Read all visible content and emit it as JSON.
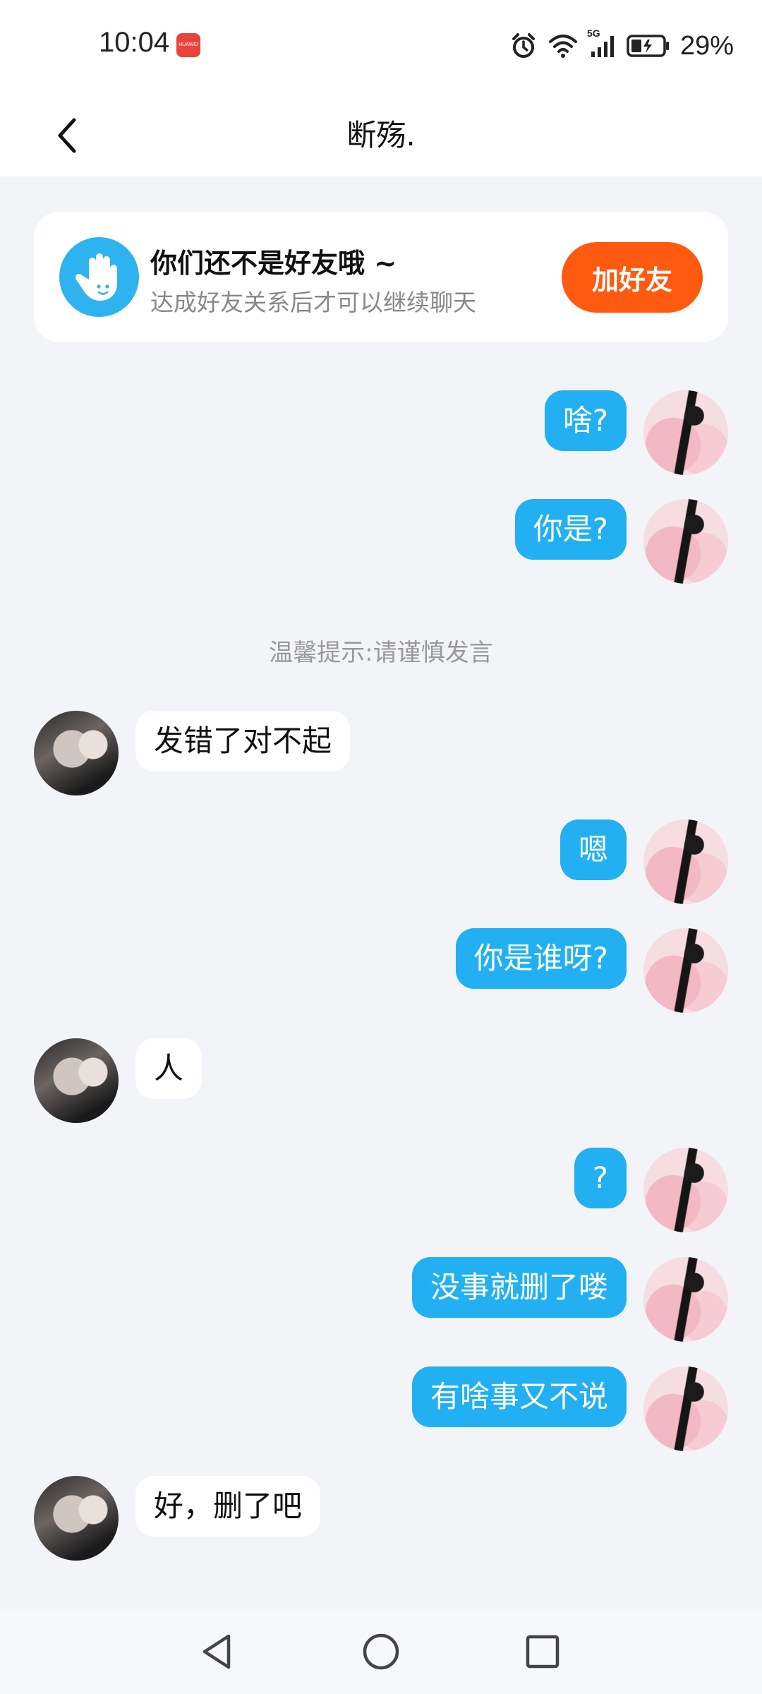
{
  "status_bar": {
    "time": "10:04",
    "app_badge": "HUAWEI",
    "network": "5G",
    "battery": "29%",
    "icons": [
      "alarm-icon",
      "wifi-icon",
      "signal-icon",
      "battery-icon"
    ]
  },
  "header": {
    "title": "断殇."
  },
  "friend_notice": {
    "title": "你们还不是好友哦 ~",
    "subtitle": "达成好友关系后才可以继续聊天",
    "button_label": "加好友"
  },
  "tip": "温馨提示:请谨慎发言",
  "messages": [
    {
      "side": "self",
      "text": "啥?"
    },
    {
      "side": "self",
      "text": "你是?"
    },
    {
      "side": "other",
      "text": "发错了对不起"
    },
    {
      "side": "self",
      "text": "嗯"
    },
    {
      "side": "self",
      "text": "你是谁呀?"
    },
    {
      "side": "other",
      "text": "人"
    },
    {
      "side": "self",
      "text": "?"
    },
    {
      "side": "self",
      "text": "没事就删了喽"
    },
    {
      "side": "self",
      "text": "有啥事又不说"
    },
    {
      "side": "other",
      "text": "好，删了吧"
    }
  ],
  "colors": {
    "self_bubble": "#22b0f2",
    "accent_button": "#ff5a0f",
    "background": "#f2f4f8"
  }
}
